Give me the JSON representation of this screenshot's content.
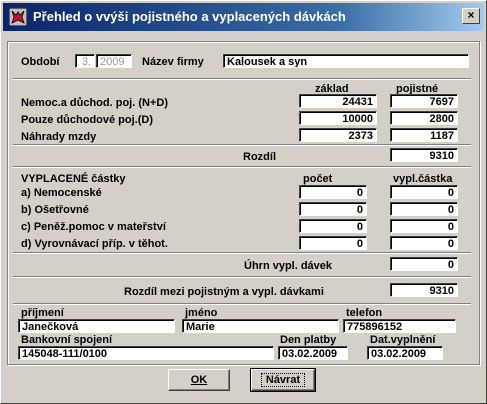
{
  "window": {
    "title": "Přehled o vvýši pojistného a vyplacených dávkách",
    "close_label": "×"
  },
  "header": {
    "obdobi_label": "Období",
    "obdobi_month": "3.",
    "obdobi_year": "2009",
    "firma_label": "Název firmy",
    "firma_value": "Kalousek a syn"
  },
  "contrib": {
    "col_zaklad": "základ",
    "col_pojistne": "pojistné",
    "rows": [
      {
        "label": "Nemoc.a důchod. poj. (N+D)",
        "zaklad": "24431",
        "pojistne": "7697"
      },
      {
        "label": "Pouze důchodové poj.(D)",
        "zaklad": "10000",
        "pojistne": "2800"
      },
      {
        "label": "Náhrady mzdy",
        "zaklad": "2373",
        "pojistne": "1187"
      }
    ],
    "rozdil_label": "Rozdíl",
    "rozdil_value": "9310"
  },
  "benefits": {
    "title": "VYPLACENÉ částky",
    "col_pocet": "počet",
    "col_castka": "vypl.částka",
    "rows": [
      {
        "label": "a) Nemocenské",
        "pocet": "0",
        "castka": "0"
      },
      {
        "label": "b) Ošetřovné",
        "pocet": "0",
        "castka": "0"
      },
      {
        "label": "c) Peněž.pomoc v mateřství",
        "pocet": "0",
        "castka": "0"
      },
      {
        "label": "d) Vyrovnávací příp. v těhot.",
        "pocet": "0",
        "castka": "0"
      }
    ],
    "uhrn_label": "Úhrn vypl. dávek",
    "uhrn_value": "0"
  },
  "summary": {
    "rozdil_label": "Rozdíl mezi pojistným a vypl. dávkami",
    "rozdil_value": "9310"
  },
  "contact": {
    "prijmeni_label": "příjmení",
    "prijmeni_value": "Janečková",
    "jmeno_label": "jméno",
    "jmeno_value": "Marie",
    "telefon_label": "telefon",
    "telefon_value": "775896152",
    "bank_label": "Bankovní spojení",
    "bank_value": "145048-111/0100",
    "den_platby_label": "Den platby",
    "den_platby_value": "03.02.2009",
    "dat_vyplneni_label": "Dat.vyplnění",
    "dat_vyplneni_value": "03.02.2009"
  },
  "buttons": {
    "ok": "OK",
    "navrat": "Návrat"
  }
}
